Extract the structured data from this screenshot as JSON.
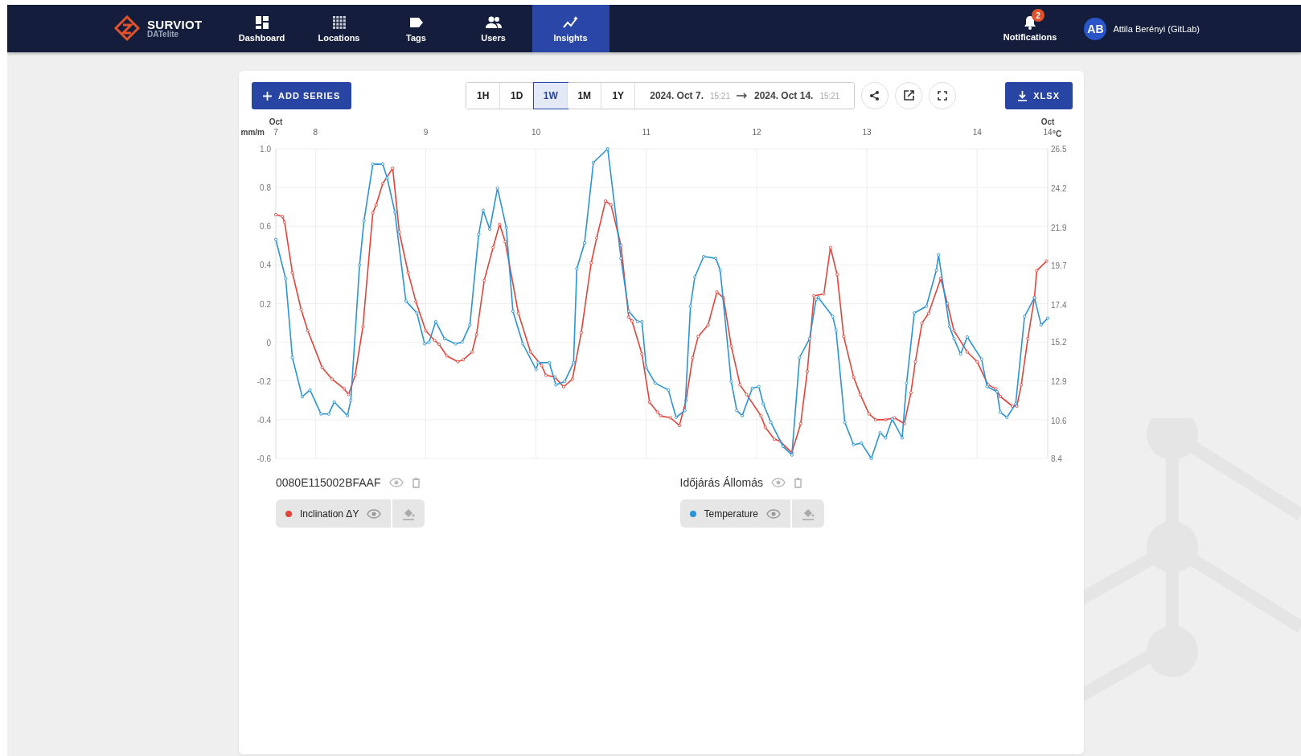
{
  "nav": {
    "logo": {
      "name": "SURVIOT",
      "sub": "DATelite"
    },
    "items": [
      {
        "label": "Dashboard",
        "selected": false
      },
      {
        "label": "Locations",
        "selected": false
      },
      {
        "label": "Tags",
        "selected": false
      },
      {
        "label": "Users",
        "selected": false
      },
      {
        "label": "Insights",
        "selected": true
      }
    ],
    "notifications": {
      "label": "Notifications",
      "count": "2"
    },
    "user": {
      "initials": "AB",
      "name": "Attila Berényi (GitLab)"
    }
  },
  "toolbar": {
    "add_button": "ADD SERIES",
    "ranges": [
      {
        "label": "1H",
        "selected": false
      },
      {
        "label": "1D",
        "selected": false
      },
      {
        "label": "1W",
        "selected": true
      },
      {
        "label": "1M",
        "selected": false
      },
      {
        "label": "1Y",
        "selected": false
      }
    ],
    "date_from": {
      "date": "2024. Oct 7.",
      "time": "15:21"
    },
    "date_to": {
      "date": "2024. Oct 14.",
      "time": "15:21"
    },
    "export_button": "XLSX"
  },
  "chart": {
    "chart_data": {
      "type": "line",
      "ylabel": "mm/m",
      "y2label": "°C",
      "xlim": [
        7.64,
        14.64
      ],
      "ylim": [
        -0.6,
        1.0
      ],
      "y2lim": [
        8.4,
        26.5
      ],
      "xticks": [
        {
          "value": 8,
          "label": "8"
        },
        {
          "value": 9,
          "label": "9"
        },
        {
          "value": 10,
          "label": "10"
        },
        {
          "value": 11,
          "label": "11"
        },
        {
          "value": 12,
          "label": "12"
        },
        {
          "value": 13,
          "label": "13"
        },
        {
          "value": 14,
          "label": "14"
        }
      ],
      "annotations": [
        "Oct 7",
        "Oct 14"
      ],
      "grid": true,
      "yticks": [
        {
          "value": 1,
          "label": "1.0"
        },
        {
          "value": 0.8,
          "label": "0.8"
        },
        {
          "value": 0.6,
          "label": "0.6"
        },
        {
          "value": 0.4,
          "label": "0.4"
        },
        {
          "value": 0.2,
          "label": "0.2"
        },
        {
          "value": 0,
          "label": "0"
        },
        {
          "value": -0.2,
          "label": "-0.2"
        },
        {
          "value": -0.4,
          "label": "-0.4"
        },
        {
          "value": -0.6,
          "label": "-0.6"
        }
      ],
      "y2ticks": [
        26.5,
        24.2,
        21.9,
        19.7,
        17.4,
        15.2,
        12.9,
        10.6,
        8.4
      ],
      "series": [
        {
          "name": "Inclination ΔY",
          "color": "#e2433a",
          "marker": "circle",
          "x": [
            7.64,
            7.7,
            7.72,
            7.79,
            7.87,
            7.93,
            8.06,
            8.15,
            8.26,
            8.3,
            8.36,
            8.43,
            8.52,
            8.55,
            8.61,
            8.7,
            8.76,
            8.84,
            8.91,
            9.0,
            9.08,
            9.12,
            9.19,
            9.29,
            9.34,
            9.42,
            9.46,
            9.53,
            9.61,
            9.67,
            9.72,
            9.84,
            9.95,
            10.05,
            10.09,
            10.17,
            10.25,
            10.33,
            10.41,
            10.5,
            10.55,
            10.63,
            10.68,
            10.77,
            10.84,
            10.87,
            10.96,
            11.03,
            11.1,
            11.13,
            11.22,
            11.3,
            11.36,
            11.42,
            11.47,
            11.56,
            11.64,
            11.7,
            11.77,
            11.85,
            11.91,
            12.04,
            12.08,
            12.16,
            12.21,
            12.32,
            12.4,
            12.46,
            12.52,
            12.61,
            12.67,
            12.73,
            12.79,
            12.88,
            12.94,
            13.02,
            13.08,
            13.17,
            13.25,
            13.34,
            13.4,
            13.44,
            13.5,
            13.56,
            13.67,
            13.73,
            13.79,
            13.91,
            14.0,
            14.1,
            14.17,
            14.21,
            14.32,
            14.36,
            14.4,
            14.46,
            14.52,
            14.54,
            14.63
          ],
          "values": [
            0.66,
            0.65,
            0.62,
            0.36,
            0.17,
            0.06,
            -0.13,
            -0.19,
            -0.24,
            -0.27,
            -0.17,
            0.08,
            0.67,
            0.71,
            0.82,
            0.9,
            0.57,
            0.36,
            0.21,
            0.06,
            0.01,
            -0.01,
            -0.07,
            -0.1,
            -0.09,
            -0.05,
            0.04,
            0.32,
            0.49,
            0.61,
            0.52,
            0.15,
            -0.05,
            -0.12,
            -0.17,
            -0.18,
            -0.23,
            -0.19,
            0.05,
            0.41,
            0.54,
            0.73,
            0.71,
            0.5,
            0.13,
            0.11,
            -0.06,
            -0.31,
            -0.36,
            -0.38,
            -0.39,
            -0.43,
            -0.3,
            -0.08,
            0.03,
            0.09,
            0.26,
            0.23,
            -0.02,
            -0.22,
            -0.27,
            -0.38,
            -0.44,
            -0.5,
            -0.51,
            -0.57,
            -0.42,
            -0.15,
            0.24,
            0.25,
            0.49,
            0.35,
            0.03,
            -0.18,
            -0.27,
            -0.37,
            -0.4,
            -0.4,
            -0.39,
            -0.42,
            -0.26,
            -0.1,
            0.1,
            0.15,
            0.33,
            0.2,
            0.06,
            -0.05,
            -0.1,
            -0.22,
            -0.24,
            -0.28,
            -0.33,
            -0.33,
            -0.22,
            0.02,
            0.23,
            0.37,
            0.42
          ]
        },
        {
          "name": "Temperature",
          "color": "#2a94d4",
          "axis": "y2",
          "marker": "circle",
          "x": [
            7.64,
            7.73,
            7.79,
            7.88,
            7.95,
            8.05,
            8.12,
            8.17,
            8.29,
            8.32,
            8.4,
            8.44,
            8.52,
            8.61,
            8.65,
            8.72,
            8.82,
            8.92,
            8.99,
            9.03,
            9.09,
            9.17,
            9.27,
            9.33,
            9.4,
            9.48,
            9.52,
            9.58,
            9.65,
            9.73,
            9.79,
            9.88,
            10.0,
            10.02,
            10.12,
            10.18,
            10.26,
            10.34,
            10.37,
            10.44,
            10.52,
            10.65,
            10.77,
            10.84,
            10.92,
            10.96,
            11.0,
            11.08,
            11.2,
            11.27,
            11.35,
            11.4,
            11.44,
            11.52,
            11.63,
            11.67,
            11.77,
            11.82,
            11.87,
            11.96,
            12.02,
            12.06,
            12.13,
            12.24,
            12.32,
            12.39,
            12.48,
            12.54,
            12.56,
            12.69,
            12.72,
            12.8,
            12.88,
            12.95,
            13.04,
            13.12,
            13.17,
            13.23,
            13.32,
            13.36,
            13.43,
            13.54,
            13.63,
            13.65,
            13.75,
            13.79,
            13.85,
            13.91,
            14.04,
            14.09,
            14.18,
            14.21,
            14.27,
            14.35,
            14.43,
            14.52,
            14.58,
            14.64
          ],
          "values": [
            21.2,
            18.9,
            14.3,
            12.0,
            12.4,
            11.0,
            11.0,
            11.7,
            10.9,
            11.8,
            19.7,
            22.3,
            25.6,
            25.6,
            24.8,
            22.8,
            17.6,
            16.9,
            15.1,
            15.2,
            16.4,
            15.4,
            15.1,
            15.2,
            16.2,
            21.5,
            22.9,
            21.8,
            24.2,
            21.9,
            17.0,
            15.1,
            13.6,
            14.0,
            14.0,
            12.7,
            12.9,
            14.0,
            19.5,
            21.0,
            25.7,
            26.5,
            20.1,
            17.0,
            16.4,
            16.4,
            13.7,
            12.8,
            12.4,
            10.8,
            11.2,
            17.3,
            19.0,
            20.2,
            20.1,
            19.4,
            12.9,
            11.2,
            10.9,
            12.5,
            12.6,
            11.6,
            10.5,
            9.1,
            8.6,
            14.3,
            15.4,
            17.7,
            17.8,
            16.7,
            15.9,
            10.5,
            9.2,
            9.3,
            8.4,
            9.9,
            9.6,
            10.7,
            9.6,
            12.8,
            16.9,
            17.3,
            19.4,
            20.3,
            16.1,
            15.4,
            14.5,
            15.5,
            14.2,
            12.6,
            12.3,
            11.1,
            10.8,
            11.6,
            16.7,
            17.8,
            16.2,
            16.6
          ]
        }
      ]
    }
  },
  "legend": [
    {
      "device": "0080E115002BFAAF"
    },
    {
      "device": "Időjárás Állomás"
    }
  ]
}
